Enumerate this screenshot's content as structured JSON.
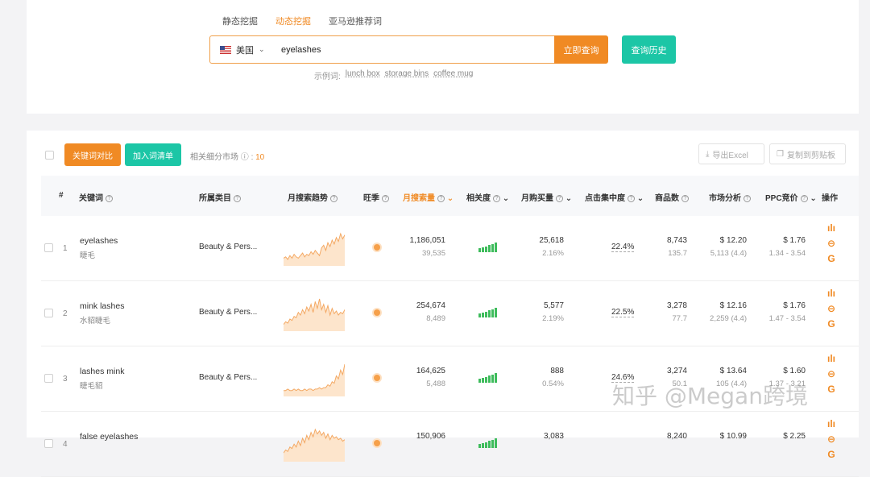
{
  "search": {
    "tabs": [
      "静态挖掘",
      "动态挖掘",
      "亚马逊推荐词"
    ],
    "active_tab": 1,
    "country": "美国",
    "query": "eyelashes",
    "query_button": "立即查询",
    "history_button": "查询历史",
    "examples_label": "示例词:",
    "examples": [
      "lunch box",
      "storage bins",
      "coffee mug"
    ]
  },
  "toolbar": {
    "compare_button": "关键词对比",
    "add_button": "加入词清单",
    "related_label": "相关细分市场",
    "related_count": "10",
    "export_button": "导出Excel",
    "copy_button": "复制到剪贴板"
  },
  "table": {
    "headers": {
      "index": "#",
      "keyword": "关键词",
      "category": "所属类目",
      "trend": "月搜索趋势",
      "peak": "旺季",
      "monthly_search": "月搜索量",
      "relevance": "相关度",
      "monthly_purchase": "月购买量",
      "click_concentration": "点击集中度",
      "product_count": "商品数",
      "market_analysis": "市场分析",
      "ppc": "PPC竞价",
      "ops": "操作"
    },
    "rows": [
      {
        "index": "1",
        "keyword": "eyelashes",
        "keyword_cn": "睫毛",
        "category": "Beauty & Pers...",
        "search_main": "1,186,051",
        "search_sub": "39,535",
        "purchase_main": "25,618",
        "purchase_sub": "2.16%",
        "concentration": "22.4%",
        "products_main": "8,743",
        "products_sub": "135.7",
        "market_main": "$ 12.20",
        "market_sub": "5,113 (4.4)",
        "ppc_main": "$ 1.76",
        "ppc_sub": "1.34 - 3.54",
        "trend": [
          6,
          7,
          5,
          8,
          6,
          9,
          7,
          6,
          8,
          10,
          7,
          9,
          8,
          11,
          9,
          12,
          10,
          8,
          14,
          16,
          12,
          18,
          15,
          20,
          17,
          22,
          19,
          25,
          21,
          24
        ]
      },
      {
        "index": "2",
        "keyword": "mink lashes",
        "keyword_cn": "水貂睫毛",
        "category": "Beauty & Pers...",
        "search_main": "254,674",
        "search_sub": "8,489",
        "purchase_main": "5,577",
        "purchase_sub": "2.19%",
        "concentration": "22.5%",
        "products_main": "3,278",
        "products_sub": "77.7",
        "market_main": "$ 12.16",
        "market_sub": "2,259 (4.4)",
        "ppc_main": "$ 1.76",
        "ppc_sub": "1.47 - 3.54",
        "trend": [
          5,
          7,
          6,
          9,
          8,
          11,
          10,
          14,
          12,
          16,
          13,
          18,
          15,
          20,
          14,
          22,
          17,
          24,
          16,
          20,
          14,
          19,
          12,
          17,
          13,
          15,
          12,
          14,
          13,
          16
        ]
      },
      {
        "index": "3",
        "keyword": "lashes mink",
        "keyword_cn": "睫毛貂",
        "category": "Beauty & Pers...",
        "search_main": "164,625",
        "search_sub": "5,488",
        "purchase_main": "888",
        "purchase_sub": "0.54%",
        "concentration": "24.6%",
        "products_main": "3,274",
        "products_sub": "50.1",
        "market_main": "$ 13.64",
        "market_sub": "105 (4.4)",
        "ppc_main": "$ 1.60",
        "ppc_sub": "1.37 - 3.21",
        "trend": [
          4,
          4,
          5,
          4,
          4,
          5,
          4,
          5,
          4,
          4,
          5,
          4,
          5,
          5,
          4,
          5,
          5,
          6,
          5,
          6,
          6,
          8,
          7,
          10,
          9,
          14,
          12,
          18,
          15,
          22
        ]
      },
      {
        "index": "4",
        "keyword": "false eyelashes",
        "keyword_cn": "",
        "category": "",
        "search_main": "150,906",
        "search_sub": "",
        "purchase_main": "3,083",
        "purchase_sub": "",
        "concentration": "",
        "products_main": "8,240",
        "products_sub": "",
        "market_main": "$ 10.99",
        "market_sub": "",
        "ppc_main": "$ 2.25",
        "ppc_sub": "",
        "trend": [
          6,
          8,
          7,
          10,
          9,
          12,
          10,
          14,
          11,
          16,
          13,
          18,
          15,
          20,
          17,
          22,
          19,
          21,
          18,
          20,
          16,
          19,
          15,
          18,
          16,
          17,
          15,
          16,
          14,
          15
        ]
      }
    ]
  },
  "watermark": "知乎 @Megan跨境",
  "colors": {
    "accent_orange": "#f08a24",
    "accent_teal": "#1cc6a6",
    "bar_green": "#3ebc5c"
  }
}
